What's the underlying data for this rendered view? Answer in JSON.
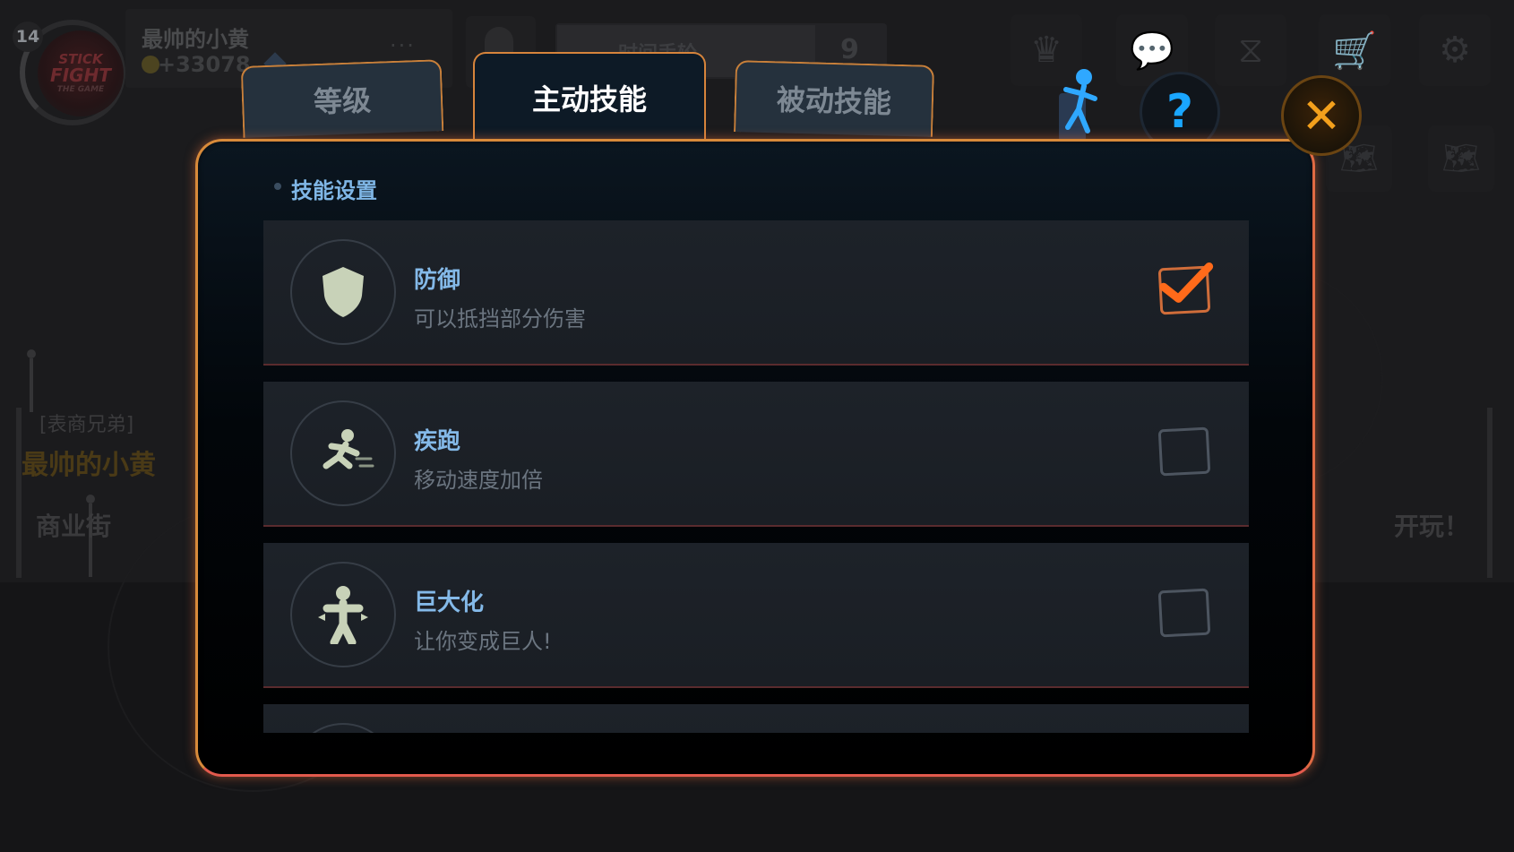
{
  "hud": {
    "level": "14",
    "logo_text": [
      "STICK",
      "FIGHT",
      "THE GAME"
    ],
    "player_name": "最帅的小黄",
    "coins": "+33078",
    "more": "...",
    "event_title": "时间手轮",
    "event_count": "9"
  },
  "background": {
    "left_tag": "[表商兄弟]",
    "left_name": "最帅的小黄",
    "left_street": "商业街",
    "right_play": "开玩！"
  },
  "tabs": [
    {
      "label": "等级",
      "active": false
    },
    {
      "label": "主动技能",
      "active": true
    },
    {
      "label": "被动技能",
      "active": false
    }
  ],
  "buttons": {
    "help": "?",
    "close": "✕"
  },
  "panel": {
    "section_title": "技能设置",
    "skills": [
      {
        "name": "防御",
        "description": "可以抵挡部分伤害",
        "icon": "shield-icon",
        "enabled": true
      },
      {
        "name": "疾跑",
        "description": "移动速度加倍",
        "icon": "sprint-icon",
        "enabled": false
      },
      {
        "name": "巨大化",
        "description": "让你变成巨人!",
        "icon": "giant-icon",
        "enabled": false
      }
    ]
  },
  "colors": {
    "accent_orange": "#d88a3a",
    "panel_border_red": "#e25a4d",
    "skill_name": "#84b9e8",
    "check_mark": "#ff6a1a",
    "help_blue": "#1aa6ff",
    "close_gold": "#f3a01c"
  }
}
